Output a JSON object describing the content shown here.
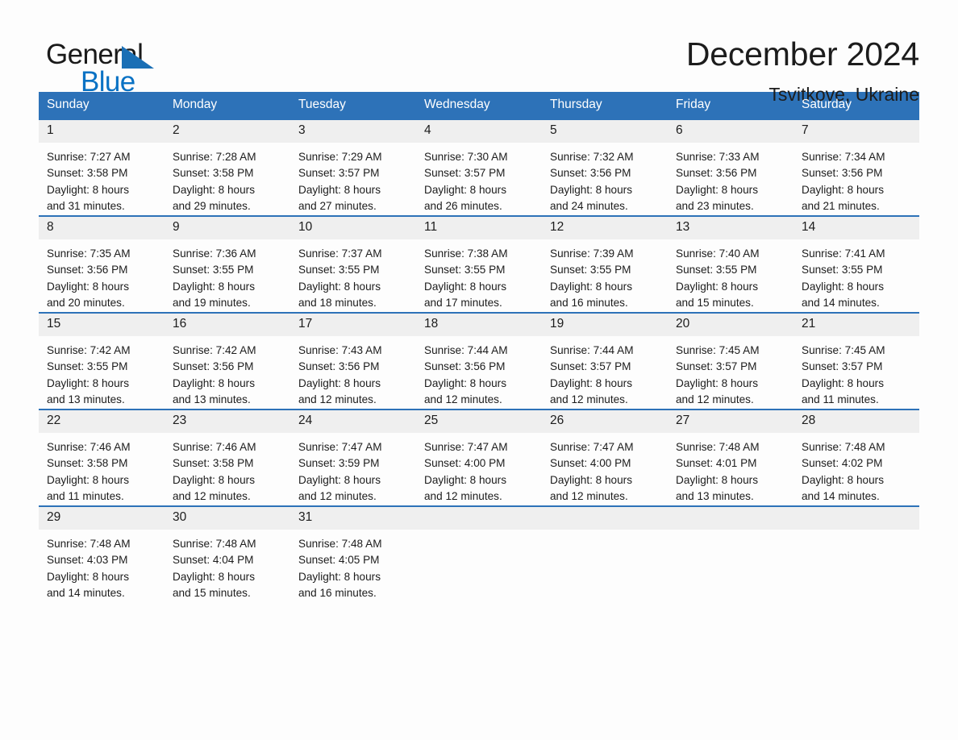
{
  "logo": {
    "text_primary": "General",
    "text_secondary": "Blue",
    "triangle_color": "#1a6fb5",
    "secondary_color": "#0a72c4"
  },
  "header": {
    "month_title": "December 2024",
    "location": "Tsvitkove, Ukraine"
  },
  "theme": {
    "header_blue": "#2d72b8",
    "daynum_band": "#efefef",
    "page_background": "#fdfdfd",
    "text": "#1c1c1c"
  },
  "calendar": {
    "weekday_headers": [
      "Sunday",
      "Monday",
      "Tuesday",
      "Wednesday",
      "Thursday",
      "Friday",
      "Saturday"
    ],
    "weeks": [
      [
        {
          "day": "1",
          "sunrise": "Sunrise: 7:27 AM",
          "sunset": "Sunset: 3:58 PM",
          "daylight_1": "Daylight: 8 hours",
          "daylight_2": "and 31 minutes."
        },
        {
          "day": "2",
          "sunrise": "Sunrise: 7:28 AM",
          "sunset": "Sunset: 3:58 PM",
          "daylight_1": "Daylight: 8 hours",
          "daylight_2": "and 29 minutes."
        },
        {
          "day": "3",
          "sunrise": "Sunrise: 7:29 AM",
          "sunset": "Sunset: 3:57 PM",
          "daylight_1": "Daylight: 8 hours",
          "daylight_2": "and 27 minutes."
        },
        {
          "day": "4",
          "sunrise": "Sunrise: 7:30 AM",
          "sunset": "Sunset: 3:57 PM",
          "daylight_1": "Daylight: 8 hours",
          "daylight_2": "and 26 minutes."
        },
        {
          "day": "5",
          "sunrise": "Sunrise: 7:32 AM",
          "sunset": "Sunset: 3:56 PM",
          "daylight_1": "Daylight: 8 hours",
          "daylight_2": "and 24 minutes."
        },
        {
          "day": "6",
          "sunrise": "Sunrise: 7:33 AM",
          "sunset": "Sunset: 3:56 PM",
          "daylight_1": "Daylight: 8 hours",
          "daylight_2": "and 23 minutes."
        },
        {
          "day": "7",
          "sunrise": "Sunrise: 7:34 AM",
          "sunset": "Sunset: 3:56 PM",
          "daylight_1": "Daylight: 8 hours",
          "daylight_2": "and 21 minutes."
        }
      ],
      [
        {
          "day": "8",
          "sunrise": "Sunrise: 7:35 AM",
          "sunset": "Sunset: 3:56 PM",
          "daylight_1": "Daylight: 8 hours",
          "daylight_2": "and 20 minutes."
        },
        {
          "day": "9",
          "sunrise": "Sunrise: 7:36 AM",
          "sunset": "Sunset: 3:55 PM",
          "daylight_1": "Daylight: 8 hours",
          "daylight_2": "and 19 minutes."
        },
        {
          "day": "10",
          "sunrise": "Sunrise: 7:37 AM",
          "sunset": "Sunset: 3:55 PM",
          "daylight_1": "Daylight: 8 hours",
          "daylight_2": "and 18 minutes."
        },
        {
          "day": "11",
          "sunrise": "Sunrise: 7:38 AM",
          "sunset": "Sunset: 3:55 PM",
          "daylight_1": "Daylight: 8 hours",
          "daylight_2": "and 17 minutes."
        },
        {
          "day": "12",
          "sunrise": "Sunrise: 7:39 AM",
          "sunset": "Sunset: 3:55 PM",
          "daylight_1": "Daylight: 8 hours",
          "daylight_2": "and 16 minutes."
        },
        {
          "day": "13",
          "sunrise": "Sunrise: 7:40 AM",
          "sunset": "Sunset: 3:55 PM",
          "daylight_1": "Daylight: 8 hours",
          "daylight_2": "and 15 minutes."
        },
        {
          "day": "14",
          "sunrise": "Sunrise: 7:41 AM",
          "sunset": "Sunset: 3:55 PM",
          "daylight_1": "Daylight: 8 hours",
          "daylight_2": "and 14 minutes."
        }
      ],
      [
        {
          "day": "15",
          "sunrise": "Sunrise: 7:42 AM",
          "sunset": "Sunset: 3:55 PM",
          "daylight_1": "Daylight: 8 hours",
          "daylight_2": "and 13 minutes."
        },
        {
          "day": "16",
          "sunrise": "Sunrise: 7:42 AM",
          "sunset": "Sunset: 3:56 PM",
          "daylight_1": "Daylight: 8 hours",
          "daylight_2": "and 13 minutes."
        },
        {
          "day": "17",
          "sunrise": "Sunrise: 7:43 AM",
          "sunset": "Sunset: 3:56 PM",
          "daylight_1": "Daylight: 8 hours",
          "daylight_2": "and 12 minutes."
        },
        {
          "day": "18",
          "sunrise": "Sunrise: 7:44 AM",
          "sunset": "Sunset: 3:56 PM",
          "daylight_1": "Daylight: 8 hours",
          "daylight_2": "and 12 minutes."
        },
        {
          "day": "19",
          "sunrise": "Sunrise: 7:44 AM",
          "sunset": "Sunset: 3:57 PM",
          "daylight_1": "Daylight: 8 hours",
          "daylight_2": "and 12 minutes."
        },
        {
          "day": "20",
          "sunrise": "Sunrise: 7:45 AM",
          "sunset": "Sunset: 3:57 PM",
          "daylight_1": "Daylight: 8 hours",
          "daylight_2": "and 12 minutes."
        },
        {
          "day": "21",
          "sunrise": "Sunrise: 7:45 AM",
          "sunset": "Sunset: 3:57 PM",
          "daylight_1": "Daylight: 8 hours",
          "daylight_2": "and 11 minutes."
        }
      ],
      [
        {
          "day": "22",
          "sunrise": "Sunrise: 7:46 AM",
          "sunset": "Sunset: 3:58 PM",
          "daylight_1": "Daylight: 8 hours",
          "daylight_2": "and 11 minutes."
        },
        {
          "day": "23",
          "sunrise": "Sunrise: 7:46 AM",
          "sunset": "Sunset: 3:58 PM",
          "daylight_1": "Daylight: 8 hours",
          "daylight_2": "and 12 minutes."
        },
        {
          "day": "24",
          "sunrise": "Sunrise: 7:47 AM",
          "sunset": "Sunset: 3:59 PM",
          "daylight_1": "Daylight: 8 hours",
          "daylight_2": "and 12 minutes."
        },
        {
          "day": "25",
          "sunrise": "Sunrise: 7:47 AM",
          "sunset": "Sunset: 4:00 PM",
          "daylight_1": "Daylight: 8 hours",
          "daylight_2": "and 12 minutes."
        },
        {
          "day": "26",
          "sunrise": "Sunrise: 7:47 AM",
          "sunset": "Sunset: 4:00 PM",
          "daylight_1": "Daylight: 8 hours",
          "daylight_2": "and 12 minutes."
        },
        {
          "day": "27",
          "sunrise": "Sunrise: 7:48 AM",
          "sunset": "Sunset: 4:01 PM",
          "daylight_1": "Daylight: 8 hours",
          "daylight_2": "and 13 minutes."
        },
        {
          "day": "28",
          "sunrise": "Sunrise: 7:48 AM",
          "sunset": "Sunset: 4:02 PM",
          "daylight_1": "Daylight: 8 hours",
          "daylight_2": "and 14 minutes."
        }
      ],
      [
        {
          "day": "29",
          "sunrise": "Sunrise: 7:48 AM",
          "sunset": "Sunset: 4:03 PM",
          "daylight_1": "Daylight: 8 hours",
          "daylight_2": "and 14 minutes."
        },
        {
          "day": "30",
          "sunrise": "Sunrise: 7:48 AM",
          "sunset": "Sunset: 4:04 PM",
          "daylight_1": "Daylight: 8 hours",
          "daylight_2": "and 15 minutes."
        },
        {
          "day": "31",
          "sunrise": "Sunrise: 7:48 AM",
          "sunset": "Sunset: 4:05 PM",
          "daylight_1": "Daylight: 8 hours",
          "daylight_2": "and 16 minutes."
        },
        {
          "day": "",
          "sunrise": "",
          "sunset": "",
          "daylight_1": "",
          "daylight_2": ""
        },
        {
          "day": "",
          "sunrise": "",
          "sunset": "",
          "daylight_1": "",
          "daylight_2": ""
        },
        {
          "day": "",
          "sunrise": "",
          "sunset": "",
          "daylight_1": "",
          "daylight_2": ""
        },
        {
          "day": "",
          "sunrise": "",
          "sunset": "",
          "daylight_1": "",
          "daylight_2": ""
        }
      ]
    ]
  }
}
